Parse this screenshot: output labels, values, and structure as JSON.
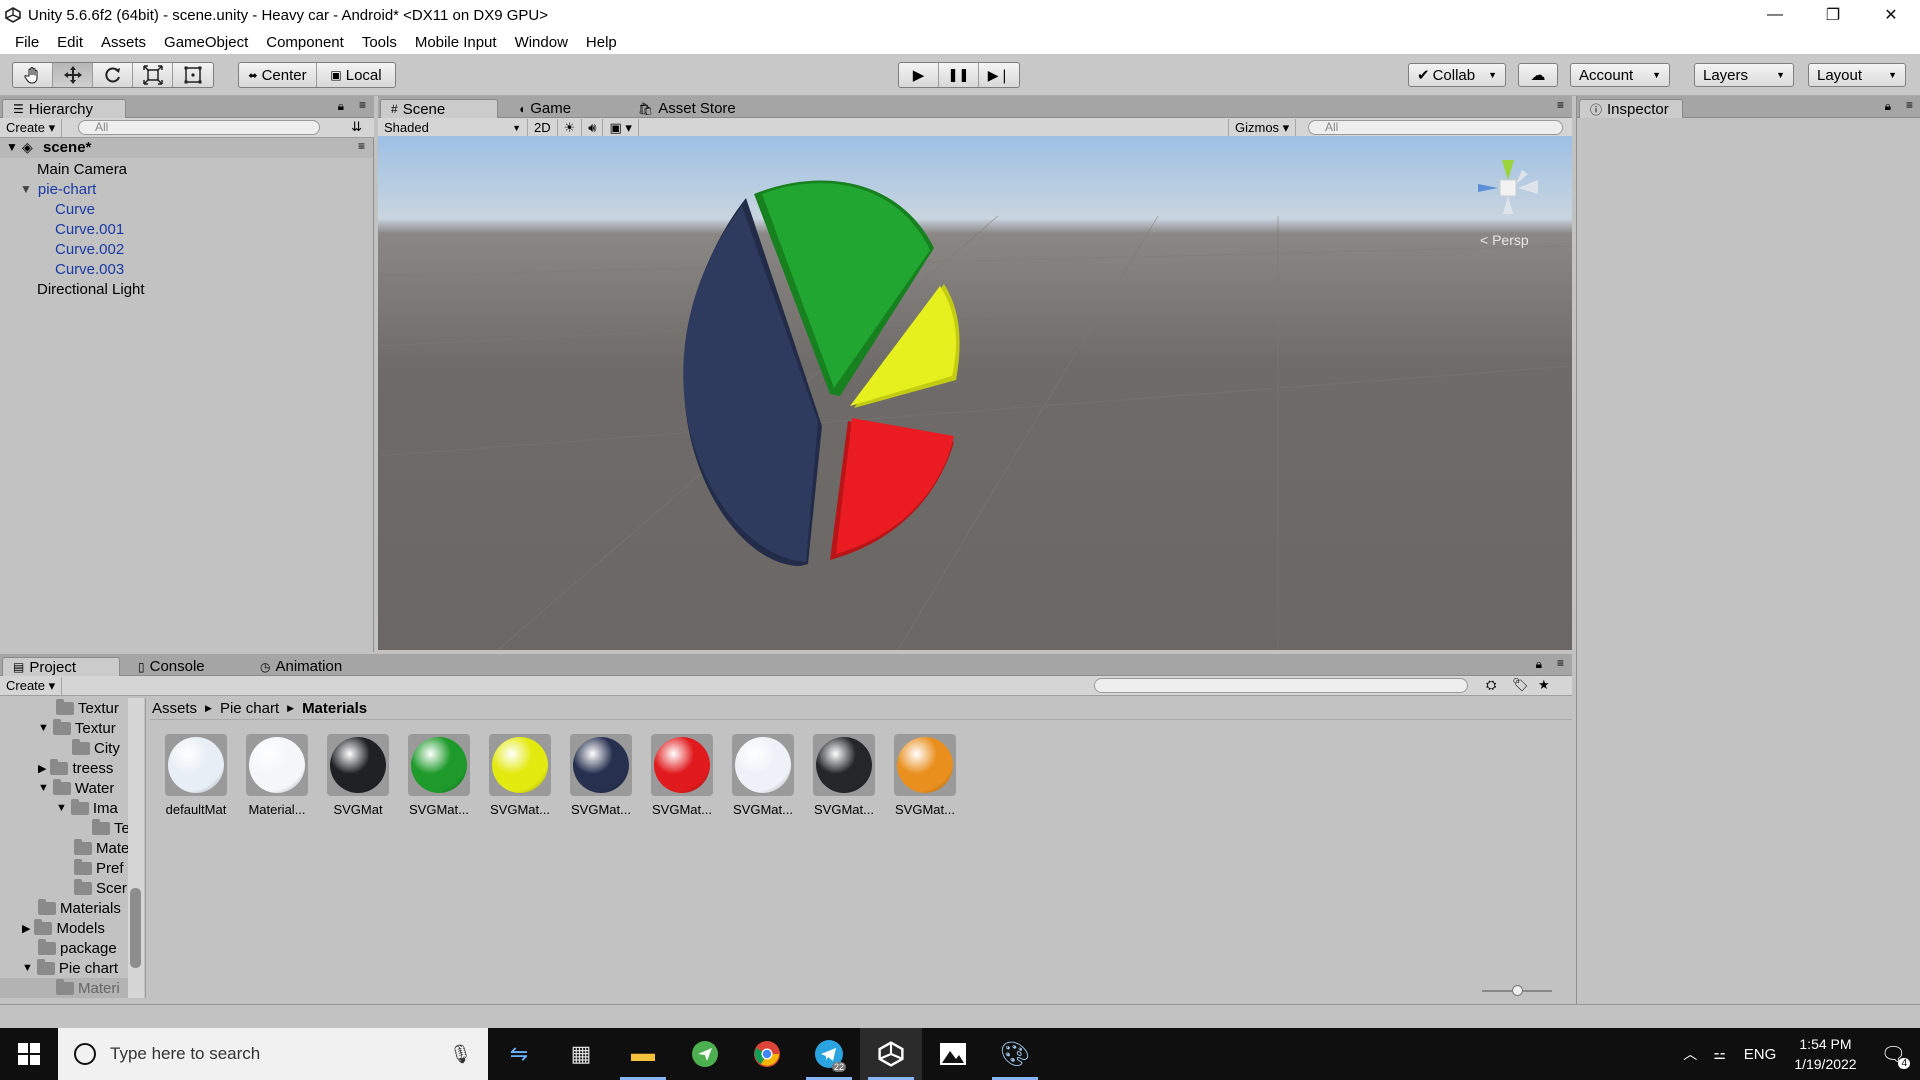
{
  "window": {
    "title": "Unity 5.6.6f2 (64bit) - scene.unity - Heavy car - Android* <DX11 on DX9 GPU>",
    "controls": {
      "minimize": "—",
      "restore": "❐",
      "close": "✕"
    }
  },
  "menu": [
    "File",
    "Edit",
    "Assets",
    "GameObject",
    "Component",
    "Tools",
    "Mobile Input",
    "Window",
    "Help"
  ],
  "toolbar": {
    "tools": [
      "hand-icon",
      "move-icon",
      "rotate-icon",
      "scale-icon",
      "rect-icon"
    ],
    "pivot": "Center",
    "space": "Local",
    "play": "▶",
    "pause": "❚❚",
    "step": "▶❘",
    "collab": "Collab",
    "account": "Account",
    "layers": "Layers",
    "layout": "Layout"
  },
  "hierarchy": {
    "tab": "Hierarchy",
    "create": "Create",
    "search_placeholder": "All",
    "scene": "scene*",
    "items": [
      {
        "label": "Main Camera",
        "level": 1
      },
      {
        "label": "pie-chart",
        "level": 1
      },
      {
        "label": "Curve",
        "level": 2
      },
      {
        "label": "Curve.001",
        "level": 2
      },
      {
        "label": "Curve.002",
        "level": 2
      },
      {
        "label": "Curve.003",
        "level": 2
      },
      {
        "label": "Directional Light",
        "level": 1
      }
    ]
  },
  "scene": {
    "tabs": [
      "Scene",
      "Game",
      "Asset Store"
    ],
    "shading": "Shaded",
    "mode2d": "2D",
    "gizmos": "Gizmos",
    "search_placeholder": "All",
    "persp": "Persp",
    "colors": {
      "navy": "#2e3a5e",
      "green": "#22a632",
      "yellow": "#e6f01e",
      "red": "#ea1c22"
    }
  },
  "inspector": {
    "tab": "Inspector"
  },
  "project": {
    "tabs": [
      "Project",
      "Console",
      "Animation"
    ],
    "create": "Create",
    "breadcrumb": [
      "Assets",
      "Pie chart",
      "Materials"
    ],
    "tree": [
      "Textur",
      "Textur",
      "City",
      "treess",
      "Water",
      "Ima",
      "Te",
      "Mate",
      "Pref",
      "Scer",
      "Materials",
      "Models",
      "package",
      "Pie chart",
      "Materi"
    ],
    "assets": [
      {
        "label": "defaultMat",
        "color": "#e8eef6"
      },
      {
        "label": "Material...",
        "color": "#f4f6fa"
      },
      {
        "label": "SVGMat",
        "color": "#202124"
      },
      {
        "label": "SVGMat...",
        "color": "#1e9a2a"
      },
      {
        "label": "SVGMat...",
        "color": "#e3ea10"
      },
      {
        "label": "SVGMat...",
        "color": "#26304f"
      },
      {
        "label": "SVGMat...",
        "color": "#e11a1d"
      },
      {
        "label": "SVGMat...",
        "color": "#eef2f8"
      },
      {
        "label": "SVGMat...",
        "color": "#24262a"
      },
      {
        "label": "SVGMat...",
        "color": "#e98f1e"
      }
    ]
  },
  "taskbar": {
    "search_placeholder": "Type here to search",
    "lang": "ENG",
    "time": "1:54 PM",
    "date": "1/19/2022",
    "notifications": "4",
    "telegram_badge": "22"
  }
}
